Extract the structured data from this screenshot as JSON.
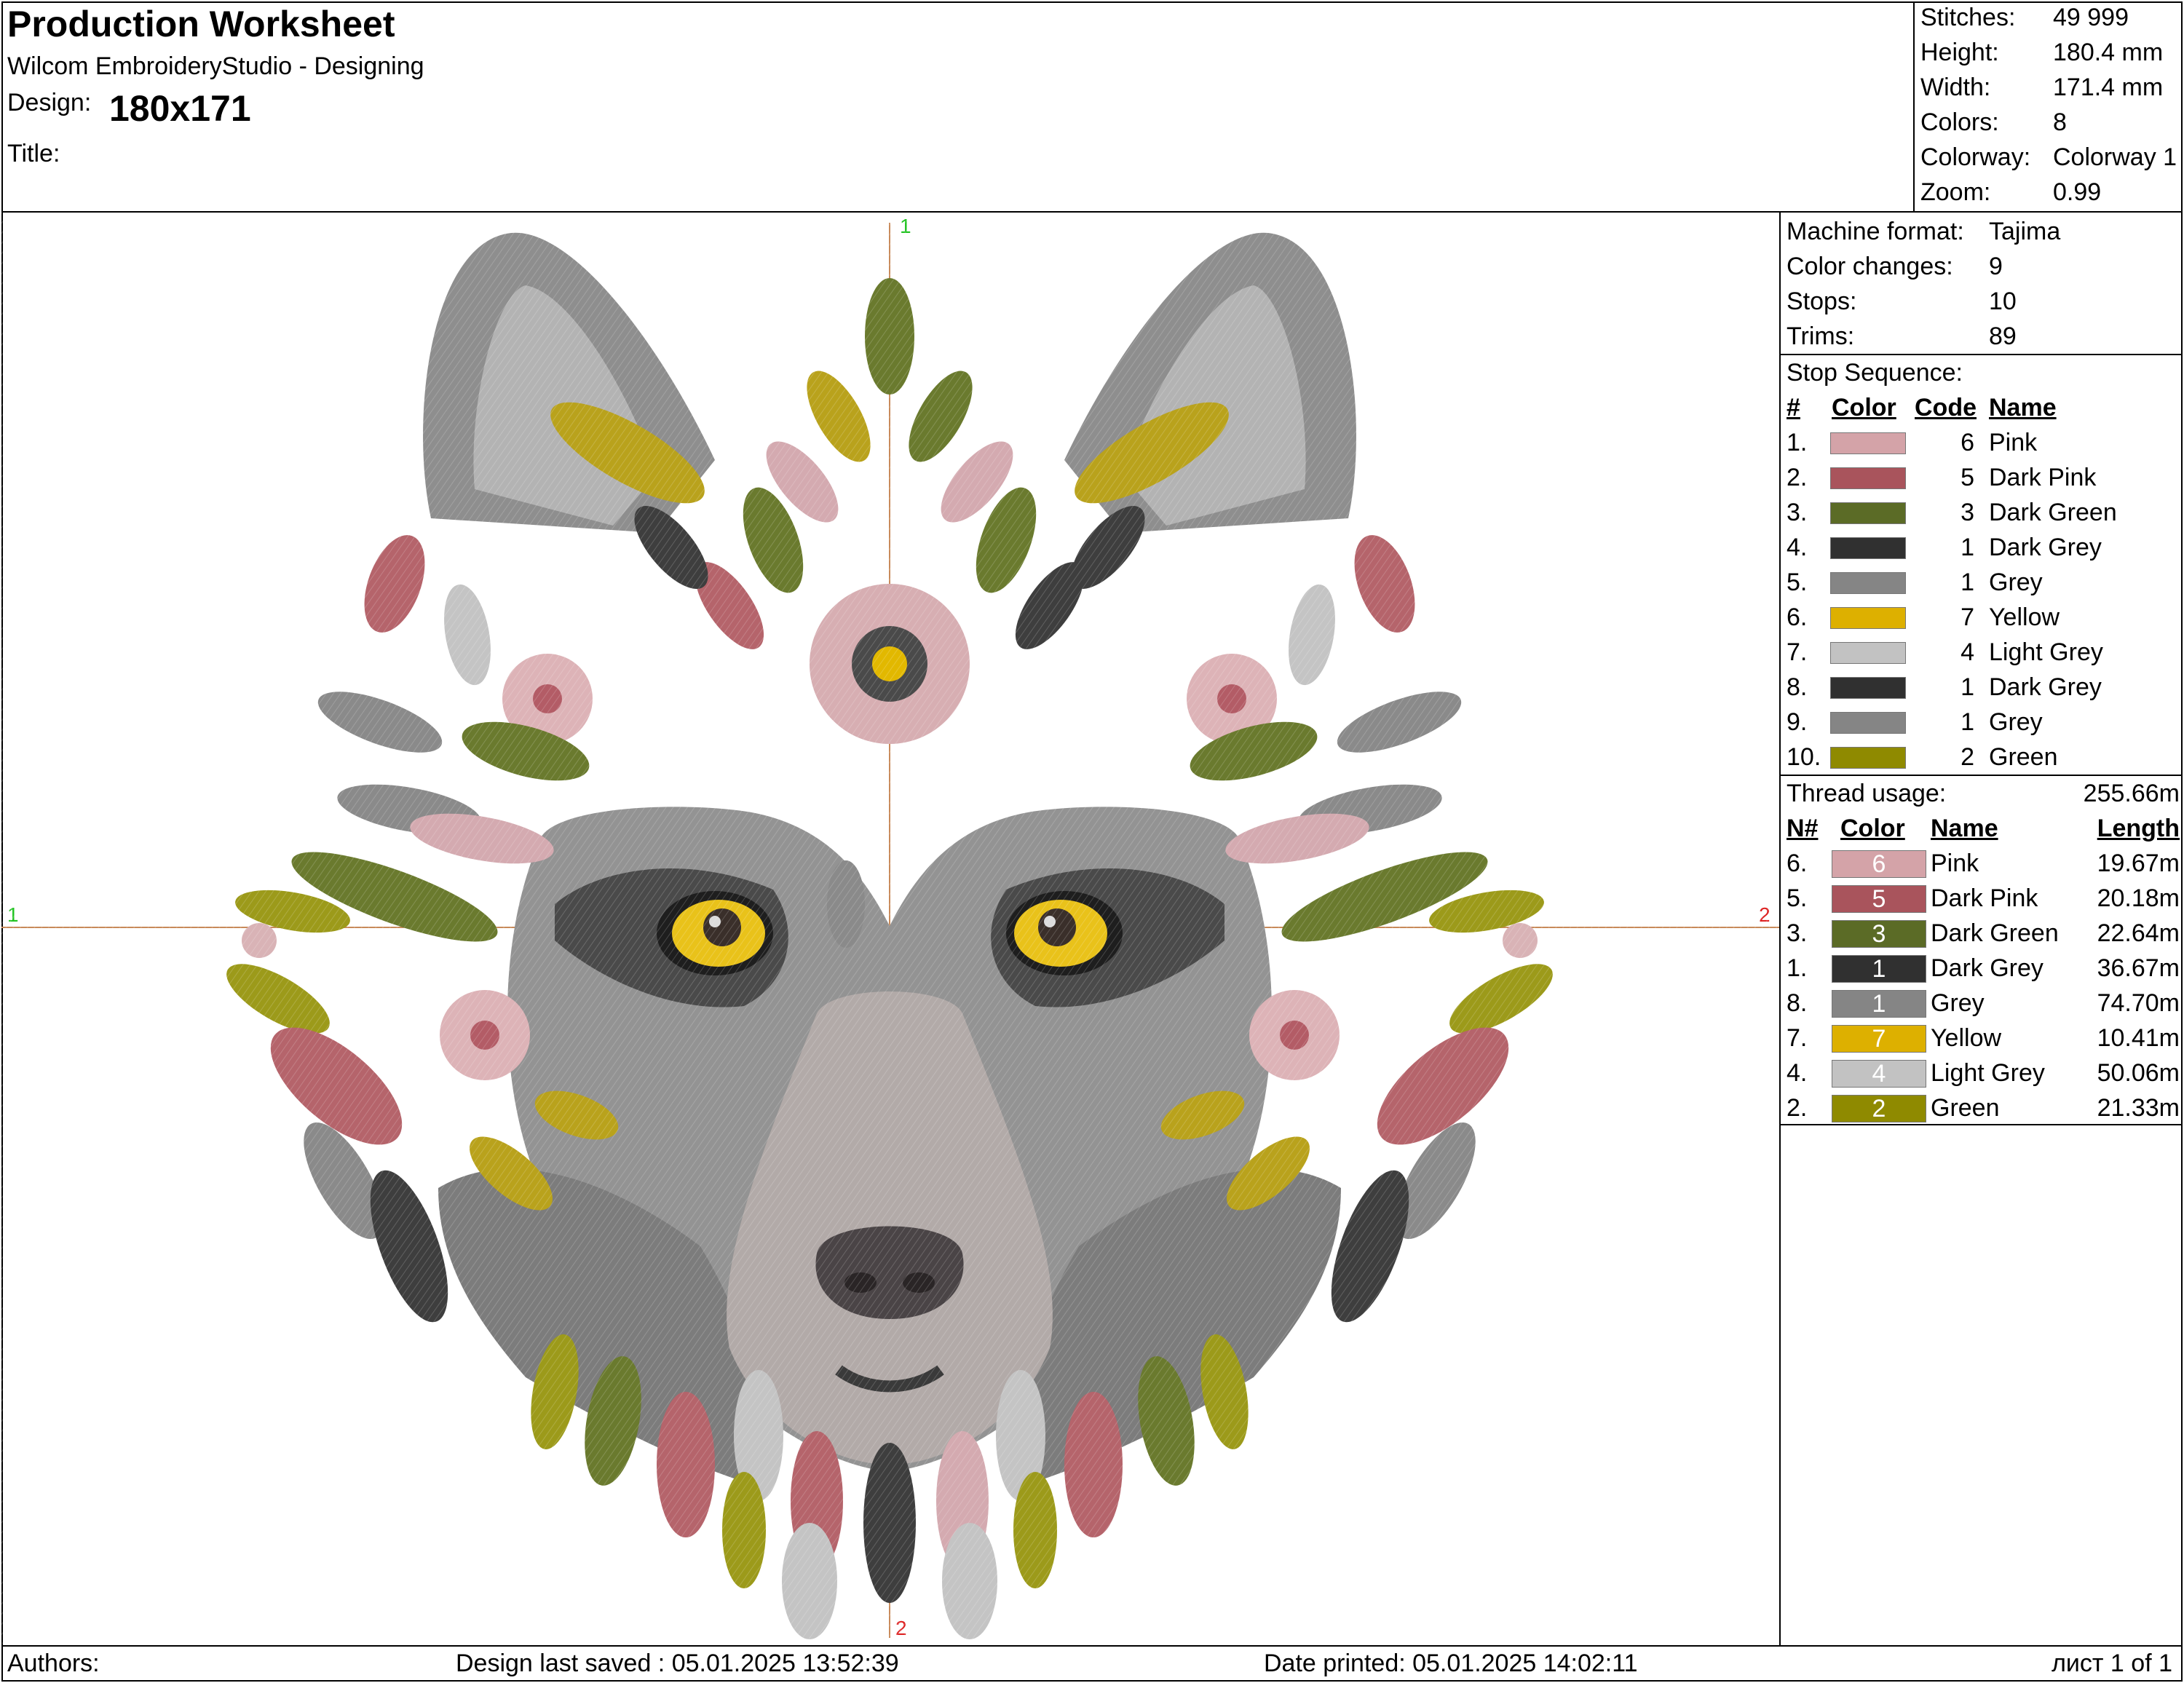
{
  "header": {
    "title": "Production Worksheet",
    "app": "Wilcom EmbroideryStudio - Designing",
    "design_label": "Design:",
    "design_value": "180x171",
    "title_label": "Title:"
  },
  "stats": [
    {
      "label": "Stitches:",
      "value": "49 999"
    },
    {
      "label": "Height:",
      "value": "180.4 mm"
    },
    {
      "label": "Width:",
      "value": "171.4 mm"
    },
    {
      "label": "Colors:",
      "value": "8"
    },
    {
      "label": "Colorway:",
      "value": "Colorway 1"
    },
    {
      "label": "Zoom:",
      "value": "0.99"
    }
  ],
  "machine": [
    {
      "label": "Machine format:",
      "value": "Tajima"
    },
    {
      "label": "Color changes:",
      "value": "9"
    },
    {
      "label": "Stops:",
      "value": "10"
    },
    {
      "label": "Trims:",
      "value": "89"
    }
  ],
  "stop_sequence": {
    "title": "Stop Sequence:",
    "headers": {
      "num": "#",
      "color": "Color",
      "code": "Code",
      "name": "Name"
    },
    "rows": [
      {
        "num": "1.",
        "color": "#d4a3a8",
        "code": "6",
        "name": "Pink"
      },
      {
        "num": "2.",
        "color": "#a9545c",
        "code": "5",
        "name": "Dark Pink"
      },
      {
        "num": "3.",
        "color": "#5b6b26",
        "code": "3",
        "name": "Dark Green"
      },
      {
        "num": "4.",
        "color": "#303030",
        "code": "1",
        "name": "Dark Grey"
      },
      {
        "num": "5.",
        "color": "#858585",
        "code": "1",
        "name": "Grey"
      },
      {
        "num": "6.",
        "color": "#ddb000",
        "code": "7",
        "name": "Yellow"
      },
      {
        "num": "7.",
        "color": "#c2c2c2",
        "code": "4",
        "name": "Light Grey"
      },
      {
        "num": "8.",
        "color": "#303030",
        "code": "1",
        "name": "Dark Grey"
      },
      {
        "num": "9.",
        "color": "#858585",
        "code": "1",
        "name": "Grey"
      },
      {
        "num": "10.",
        "color": "#8f8a00",
        "code": "2",
        "name": "Green"
      }
    ]
  },
  "thread_usage": {
    "title": "Thread usage:",
    "total": "255.66m",
    "headers": {
      "num": "N#",
      "color": "Color",
      "name": "Name",
      "length": "Length"
    },
    "rows": [
      {
        "num": "6.",
        "color": "#d4a3a8",
        "code": "6",
        "name": "Pink",
        "length": "19.67m"
      },
      {
        "num": "5.",
        "color": "#a9545c",
        "code": "5",
        "name": "Dark Pink",
        "length": "20.18m"
      },
      {
        "num": "3.",
        "color": "#5b6b26",
        "code": "3",
        "name": "Dark Green",
        "length": "22.64m"
      },
      {
        "num": "1.",
        "color": "#303030",
        "code": "1",
        "name": "Dark Grey",
        "length": "36.67m"
      },
      {
        "num": "8.",
        "color": "#858585",
        "code": "1",
        "name": "Grey",
        "length": "74.70m"
      },
      {
        "num": "7.",
        "color": "#ddb000",
        "code": "7",
        "name": "Yellow",
        "length": "10.41m"
      },
      {
        "num": "4.",
        "color": "#c2c2c2",
        "code": "4",
        "name": "Light Grey",
        "length": "50.06m"
      },
      {
        "num": "2.",
        "color": "#8f8a00",
        "code": "2",
        "name": "Green",
        "length": "21.33m"
      }
    ]
  },
  "canvas": {
    "markers": {
      "top": "1",
      "left": "1",
      "right": "2",
      "bottom": "2"
    }
  },
  "footer": {
    "authors": "Authors:",
    "saved": "Design last saved : 05.01.2025 13:52:39",
    "printed": "Date printed: 05.01.2025 14:02:11",
    "sheet": "лист 1 of 1"
  }
}
